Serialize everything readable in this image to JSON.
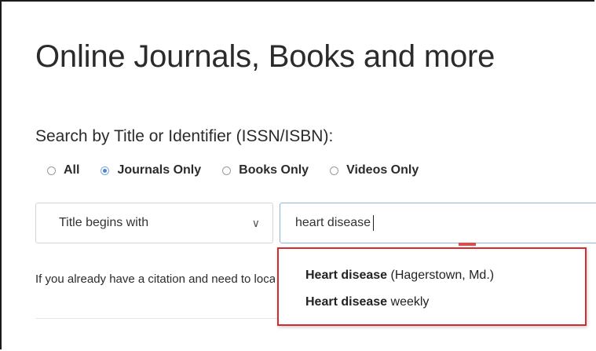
{
  "page": {
    "title": "Online Journals, Books and more"
  },
  "search": {
    "label": "Search by Title or Identifier (ISSN/ISBN):",
    "filters": [
      {
        "label": "All",
        "checked": false
      },
      {
        "label": "Journals Only",
        "checked": true
      },
      {
        "label": "Books Only",
        "checked": false
      },
      {
        "label": "Videos Only",
        "checked": false
      }
    ],
    "mode_select": {
      "value": "Title begins with"
    },
    "query": "heart disease"
  },
  "citation_text": "If you already have a citation and need to locate the full text",
  "suggestions": [
    {
      "match": "Heart disease",
      "rest": " (Hagerstown, Md.)"
    },
    {
      "match": "Heart disease",
      "rest": " weekly"
    }
  ],
  "colors": {
    "highlight_border": "#d62b2b",
    "radio_selected": "#4a86d4",
    "input_focus_border": "#8eb3e6"
  },
  "icons": {
    "select_chevron": "chevron-down-icon"
  }
}
